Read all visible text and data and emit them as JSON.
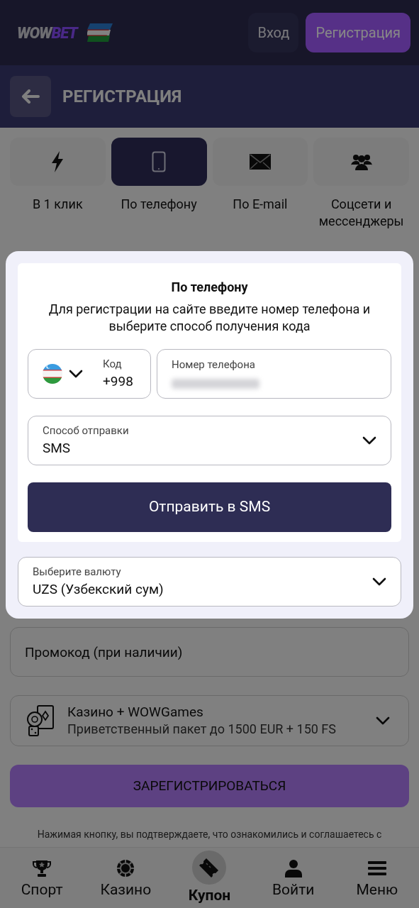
{
  "header": {
    "logo_left": "WOW",
    "logo_right": "BET",
    "login_button": "Вход",
    "register_button": "Регистрация"
  },
  "page_title": "РЕГИСТРАЦИЯ",
  "methods": [
    {
      "kind": "bolt",
      "label": "В 1 клик",
      "selected": false
    },
    {
      "kind": "phone",
      "label": "По телефону",
      "selected": true
    },
    {
      "kind": "mail",
      "label": "По E-mail",
      "selected": false
    },
    {
      "kind": "people",
      "label": "Соцсети и мессенджеры",
      "selected": false
    }
  ],
  "phone_form": {
    "title": "По телефону",
    "description": "Для регистрации на сайте введите номер телефона и выберите способ получения кода",
    "code_label": "Код",
    "code_value": "+998",
    "phone_label": "Номер телефона",
    "send_method_label": "Способ отправки",
    "send_method_value": "SMS",
    "send_button": "Отправить в SMS"
  },
  "currency": {
    "label": "Выберите валюту",
    "value": "UZS (Узбекский сум)"
  },
  "promo": {
    "placeholder": "Промокод (при наличии)"
  },
  "bonus": {
    "title": "Казино + WOWGames",
    "subtitle": "Приветственный пакет до 1500 EUR + 150 FS"
  },
  "submit_button": "ЗАРЕГИСТРИРОВАТЬСЯ",
  "terms": "Нажимая кнопку, вы подтверждаете, что ознакомились и соглашаетесь с",
  "bottom_nav": [
    {
      "kind": "trophy",
      "label": "Спорт",
      "selected": false
    },
    {
      "kind": "chip",
      "label": "Казино",
      "selected": false
    },
    {
      "kind": "ticket",
      "label": "Купон",
      "selected": true
    },
    {
      "kind": "user",
      "label": "Войти",
      "selected": false
    },
    {
      "kind": "menu",
      "label": "Меню",
      "selected": false
    }
  ]
}
